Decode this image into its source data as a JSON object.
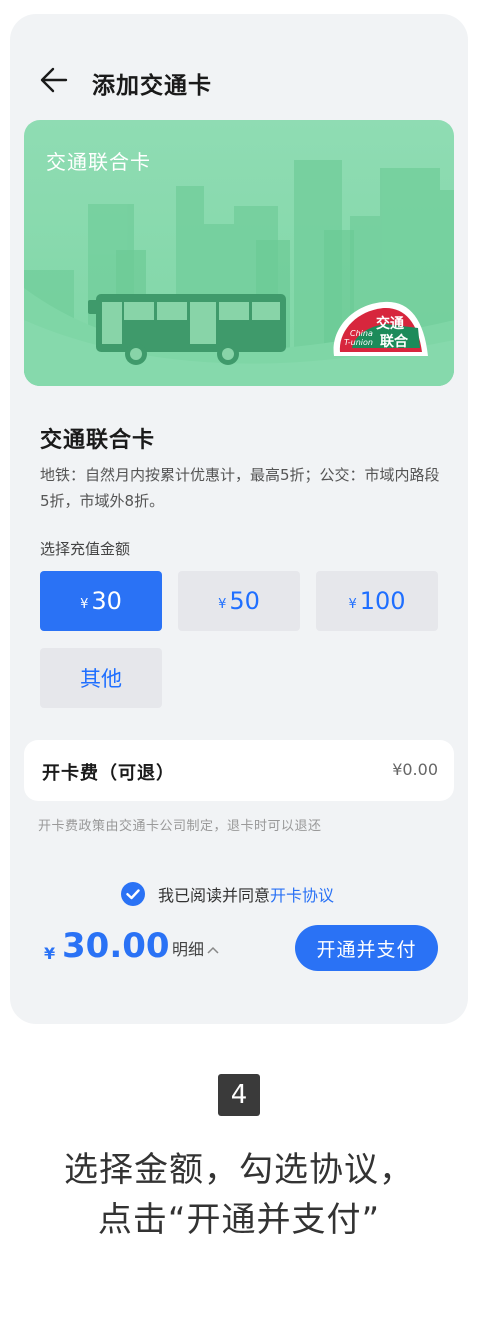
{
  "header": {
    "title": "添加交通卡"
  },
  "card": {
    "name": "交通联合卡",
    "logo_text": "交通联合",
    "logo_sub": "China T-union"
  },
  "info": {
    "title": "交通联合卡",
    "desc": "地铁：自然月内按累计优惠计，最高5折；公交：市域内路段5折，市域外8折。"
  },
  "recharge": {
    "label": "选择充值金额",
    "currency": "¥",
    "options": [
      {
        "amount": "30",
        "selected": true
      },
      {
        "amount": "50",
        "selected": false
      },
      {
        "amount": "100",
        "selected": false
      }
    ],
    "other_label": "其他"
  },
  "fee": {
    "label": "开卡费（可退）",
    "value": "¥0.00",
    "note": "开卡费政策由交通卡公司制定，退卡时可以退还"
  },
  "agreement": {
    "checked": true,
    "text": "我已阅读并同意",
    "link": "开卡协议"
  },
  "bottom": {
    "currency": "¥",
    "total": "30.00",
    "detail_label": "明细",
    "pay_label": "开通并支付"
  },
  "step": {
    "number": "4",
    "line1": "选择金额，勾选协议，",
    "line2": "点击“开通并支付”"
  },
  "colors": {
    "accent": "#2a72f5",
    "card_green": "#86d9ac",
    "phone_bg": "#f1f3f5",
    "logo_red": "#d7263d"
  }
}
